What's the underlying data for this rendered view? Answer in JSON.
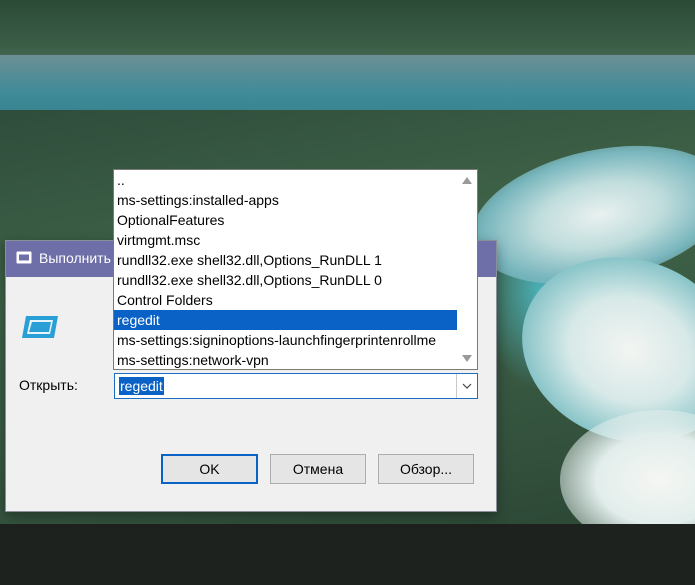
{
  "dialog": {
    "title": "Выполнить",
    "open_label": "Открыть:",
    "input_value": "regedit"
  },
  "dropdown": {
    "items": [
      "..",
      "ms-settings:installed-apps",
      "OptionalFeatures",
      "virtmgmt.msc",
      "rundll32.exe shell32.dll,Options_RunDLL 1",
      "rundll32.exe shell32.dll,Options_RunDLL 0",
      "Control Folders",
      "regedit",
      "ms-settings:signinoptions-launchfingerprintenrollme",
      "ms-settings:network-vpn"
    ],
    "selected_index": 7
  },
  "buttons": {
    "ok": "OK",
    "cancel": "Отмена",
    "browse": "Обзор..."
  },
  "icons": {
    "title_icon": "run-app-icon",
    "dialog_icon": "run-app-icon",
    "dropdown_arrow": "chevron-down-icon",
    "scroll_up": "scroll-up-arrow-icon",
    "scroll_down": "scroll-down-arrow-icon"
  },
  "colors": {
    "titlebar": "#6e6ea8",
    "selection": "#0a62c7",
    "ok_border": "#0a62c7"
  }
}
